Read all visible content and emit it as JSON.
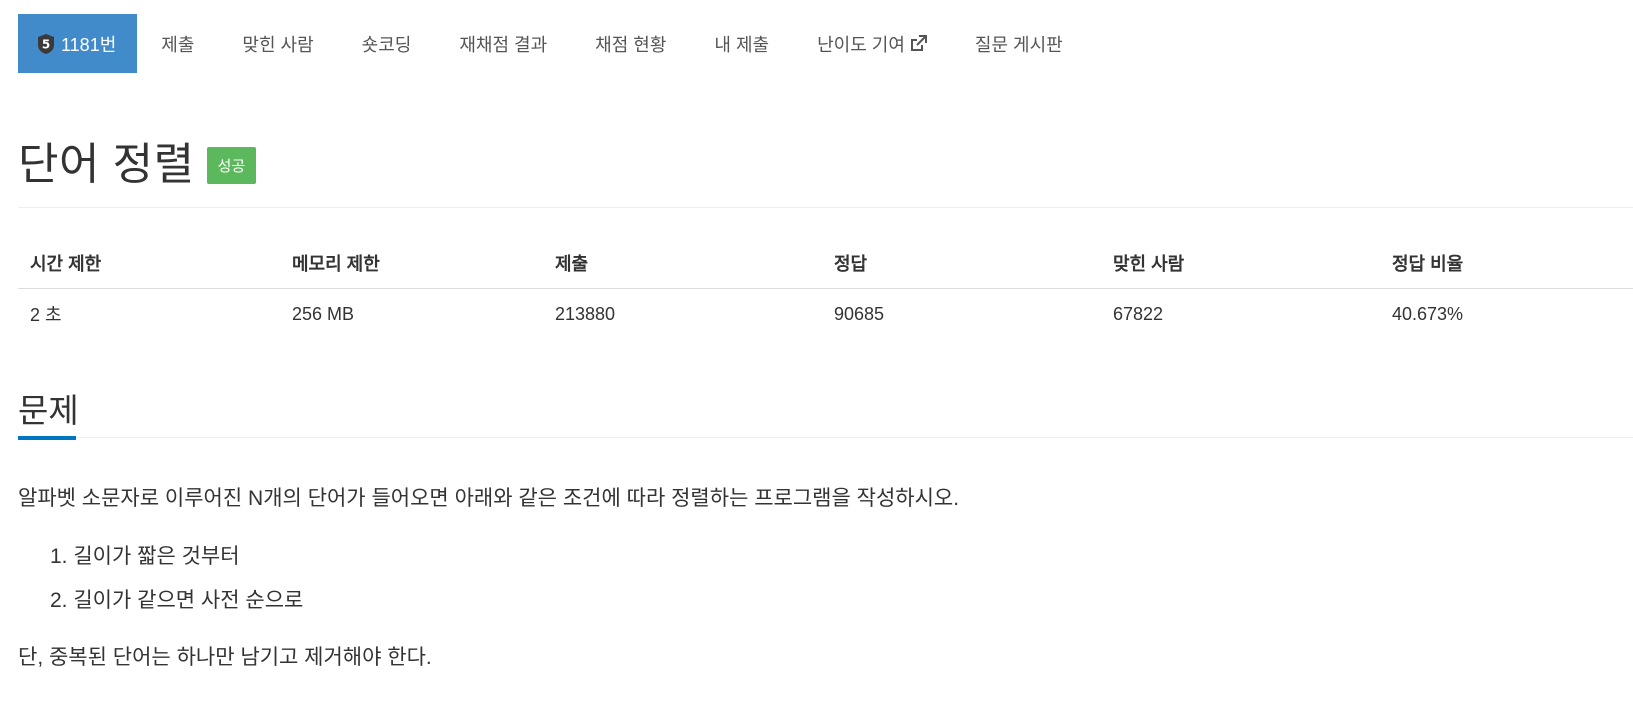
{
  "nav": {
    "problem_id_tab": "1181번",
    "tier_badge": "5",
    "tier_color": "#3a3a3a",
    "items": [
      {
        "label": "제출"
      },
      {
        "label": "맞힌 사람"
      },
      {
        "label": "숏코딩"
      },
      {
        "label": "재채점 결과"
      },
      {
        "label": "채점 현황"
      },
      {
        "label": "내 제출"
      },
      {
        "label": "난이도 기여",
        "icon": "external-link-icon"
      },
      {
        "label": "질문 게시판"
      }
    ]
  },
  "problem": {
    "title": "단어 정렬",
    "status_badge": "성공",
    "status_color": "#5cb85c"
  },
  "info_table": {
    "headers": [
      "시간 제한",
      "메모리 제한",
      "제출",
      "정답",
      "맞힌 사람",
      "정답 비율"
    ],
    "values": [
      "2 초",
      "256 MB",
      "213880",
      "90685",
      "67822",
      "40.673%"
    ]
  },
  "section": {
    "title": "문제",
    "paragraph1": "알파벳 소문자로 이루어진 N개의 단어가 들어오면 아래와 같은 조건에 따라 정렬하는 프로그램을 작성하시오.",
    "conditions": [
      "1. 길이가 짧은 것부터",
      "2. 길이가 같으면 사전 순으로"
    ],
    "paragraph2": "단, 중복된 단어는 하나만 남기고 제거해야 한다."
  },
  "colors": {
    "active_tab": "#428bca",
    "section_accent": "#0076c0"
  }
}
